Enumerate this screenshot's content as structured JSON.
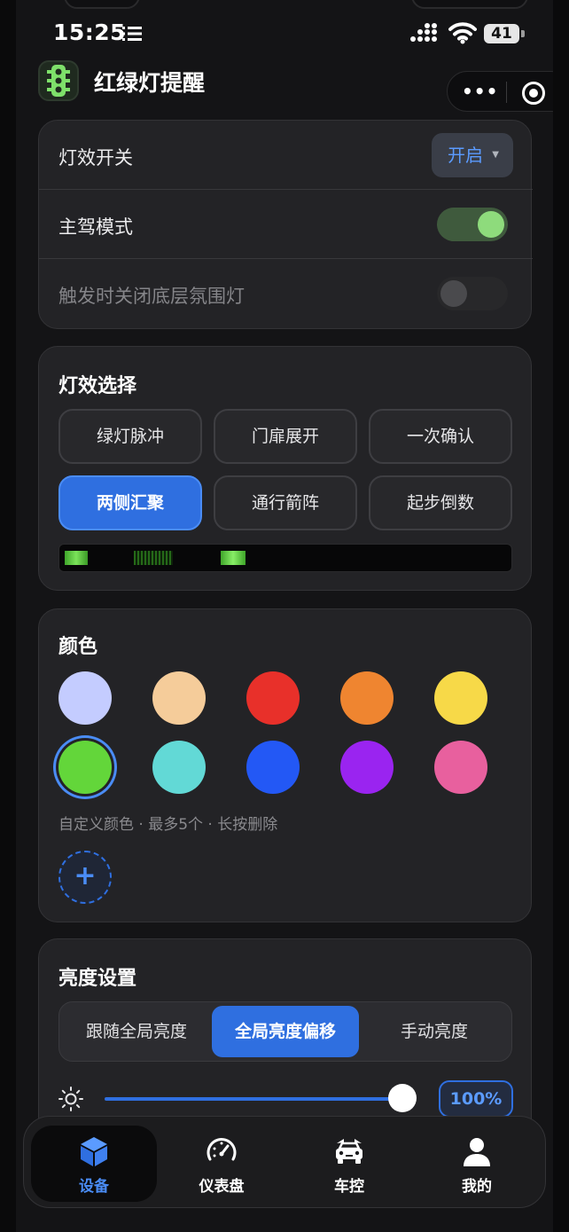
{
  "status_bar": {
    "time": "15:25",
    "battery": "41"
  },
  "app": {
    "title": "红绿灯提醒"
  },
  "settings": {
    "effect_switch": {
      "label": "灯效开关",
      "value": "开启"
    },
    "driver_mode": {
      "label": "主驾模式",
      "on": true
    },
    "ambient_off": {
      "label": "触发时关闭底层氛围灯",
      "on": false
    }
  },
  "effects": {
    "title": "灯效选择",
    "options": [
      {
        "label": "绿灯脉冲",
        "active": false
      },
      {
        "label": "门扉展开",
        "active": false
      },
      {
        "label": "一次确认",
        "active": false
      },
      {
        "label": "两侧汇聚",
        "active": true
      },
      {
        "label": "通行箭阵",
        "active": false
      },
      {
        "label": "起步倒数",
        "active": false
      }
    ]
  },
  "colors": {
    "title": "颜色",
    "swatches": [
      "#c4ccff",
      "#f5cc9a",
      "#e8302a",
      "#ef8530",
      "#f7d948",
      "#63d63a",
      "#62d9d6",
      "#2358f5",
      "#9a24f0",
      "#e8609e"
    ],
    "selected_index": 5,
    "hint": "自定义颜色 · 最多5个 · 长按删除",
    "add_symbol": "+"
  },
  "brightness": {
    "title": "亮度设置",
    "modes": [
      {
        "label": "跟随全局亮度",
        "active": false
      },
      {
        "label": "全局亮度偏移",
        "active": true
      },
      {
        "label": "手动亮度",
        "active": false
      }
    ],
    "value_percent": 100,
    "value_label": "100%"
  },
  "tabbar": {
    "items": [
      {
        "label": "设备",
        "icon": "cube-icon",
        "active": true
      },
      {
        "label": "仪表盘",
        "icon": "gauge-icon",
        "active": false
      },
      {
        "label": "车控",
        "icon": "car-icon",
        "active": false
      },
      {
        "label": "我的",
        "icon": "user-icon",
        "active": false
      }
    ]
  },
  "accent_color": "#2f6fe0"
}
